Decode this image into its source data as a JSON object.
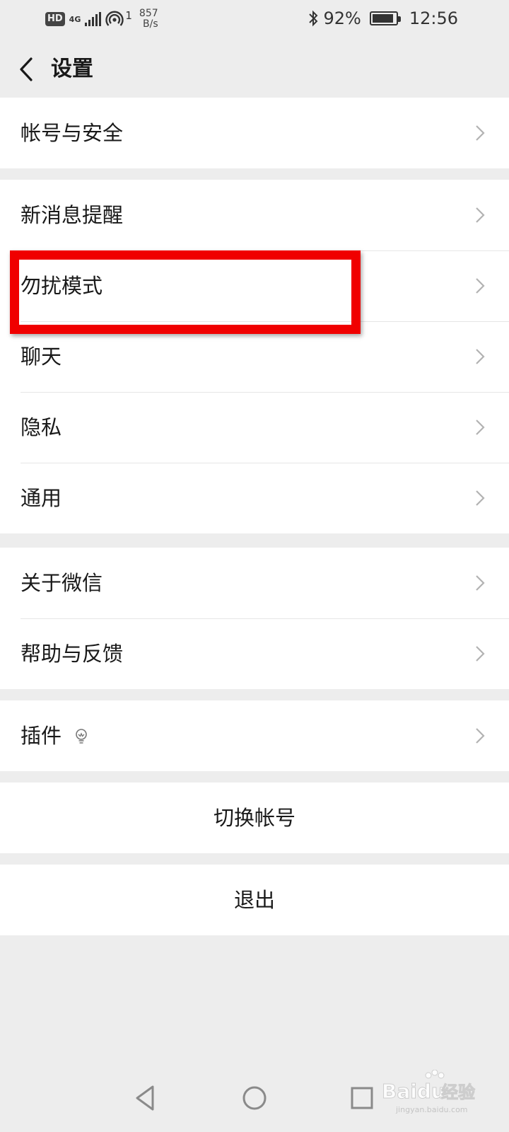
{
  "status_bar": {
    "hd": "HD",
    "network": "4G",
    "speed_value": "857",
    "speed_unit": "B/s",
    "hotspot_count": "1",
    "battery_percent": "92%",
    "battery_level": 0.92,
    "time": "12:56"
  },
  "header": {
    "title": "设置"
  },
  "groups": [
    {
      "items": [
        {
          "label": "帐号与安全"
        }
      ]
    },
    {
      "items": [
        {
          "label": "新消息提醒"
        },
        {
          "label": "勿扰模式"
        },
        {
          "label": "聊天"
        },
        {
          "label": "隐私"
        },
        {
          "label": "通用"
        }
      ]
    },
    {
      "items": [
        {
          "label": "关于微信"
        },
        {
          "label": "帮助与反馈"
        }
      ]
    },
    {
      "items": [
        {
          "label": "插件",
          "icon": "lightbulb-icon"
        }
      ]
    }
  ],
  "actions": {
    "switch_account": "切换帐号",
    "logout": "退出"
  },
  "watermark": {
    "brand": "Baidu",
    "label": "经验",
    "subtext": "jingyan.baidu.com"
  },
  "colors": {
    "page_bg": "#ededed",
    "row_bg": "#ffffff",
    "highlight": "#f00000",
    "chevron": "#b2b2b2"
  }
}
